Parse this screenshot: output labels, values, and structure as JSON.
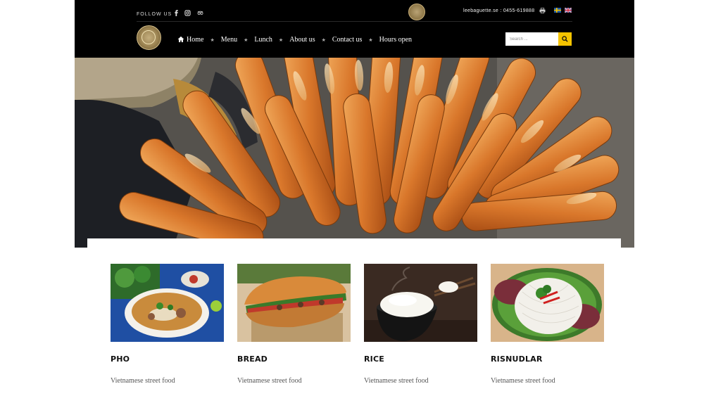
{
  "header": {
    "follow_label": "FOLLOW US",
    "social_icons": [
      "facebook-icon",
      "instagram-icon",
      "tripadvisor-icon"
    ],
    "contact_text": "leebaguette.se : 0455-619888",
    "languages": [
      "sv",
      "en"
    ]
  },
  "nav": {
    "items": [
      {
        "label": "Home",
        "icon": "home-icon"
      },
      {
        "label": "Menu"
      },
      {
        "label": "Lunch"
      },
      {
        "label": "About us"
      },
      {
        "label": "Contact us"
      },
      {
        "label": "Hours open"
      }
    ]
  },
  "search": {
    "placeholder": "Search ..."
  },
  "cards": [
    {
      "title": "PHO",
      "subtitle": "Vietnamese street food"
    },
    {
      "title": "BREAD",
      "subtitle": "Vietnamese street food"
    },
    {
      "title": "RICE",
      "subtitle": "Vietnamese street food"
    },
    {
      "title": "RISNUDLAR",
      "subtitle": "Vietnamese street food"
    }
  ],
  "colors": {
    "header_bg": "#000000",
    "accent": "#f5c400",
    "gold": "#b9a274"
  }
}
